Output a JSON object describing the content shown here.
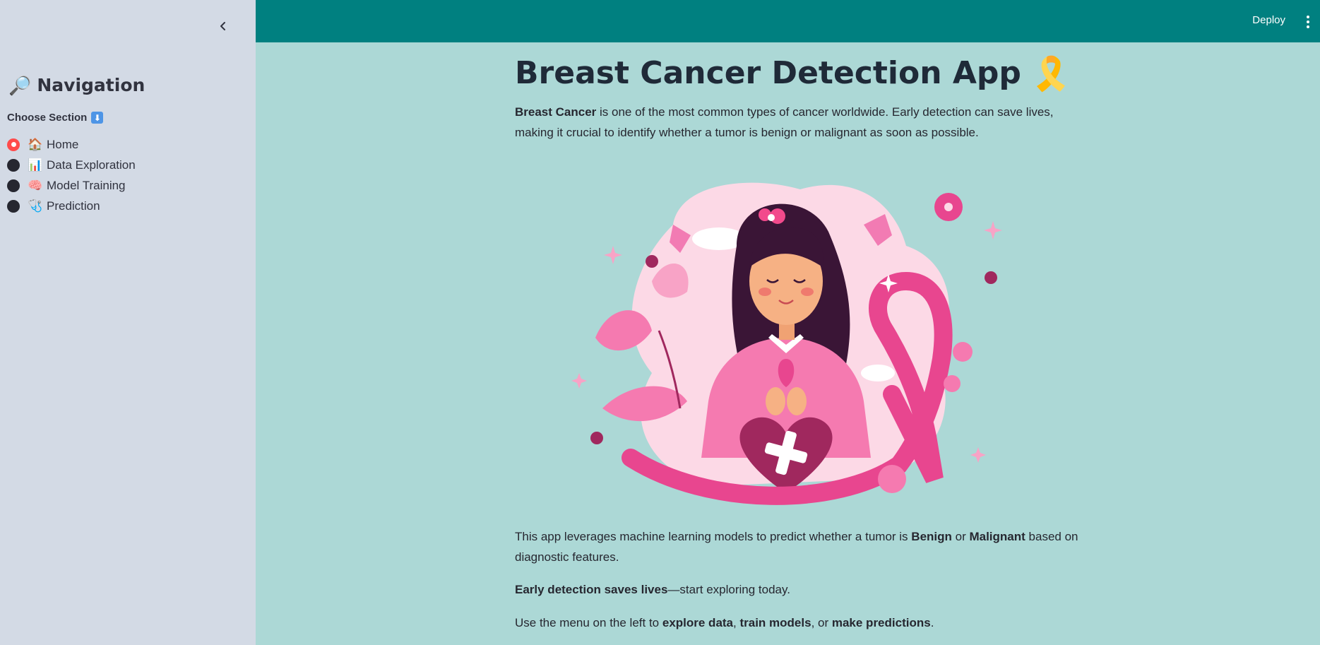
{
  "sidebar": {
    "collapse_icon": "chevron-left-icon",
    "title_emoji": "🔎",
    "title": "Navigation",
    "choose_label": "Choose Section",
    "choose_icon": "⬇",
    "items": [
      {
        "emoji": "🏠",
        "label": "Home",
        "selected": true
      },
      {
        "emoji": "📊",
        "label": "Data Exploration",
        "selected": false
      },
      {
        "emoji": "🧠",
        "label": "Model Training",
        "selected": false
      },
      {
        "emoji": "🩺",
        "label": "Prediction",
        "selected": false
      }
    ]
  },
  "header": {
    "deploy_label": "Deploy",
    "menu_icon": "kebab-menu-icon",
    "background": "#008080"
  },
  "main": {
    "title": "Breast Cancer Detection App",
    "title_emoji": "🎗️",
    "intro": {
      "bold": "Breast Cancer",
      "text": " is one of the most common types of cancer worldwide. Early detection can save lives, making it crucial to identify whether a tumor is benign or malignant as soon as possible."
    },
    "para2": {
      "t1": "This app leverages machine learning models to predict whether a tumor is ",
      "b1": "Benign",
      "t2": " or ",
      "b2": "Malignant",
      "t3": " based on diagnostic features."
    },
    "para3": {
      "b1": "Early detection saves lives",
      "t1": "—start exploring today."
    },
    "para4": {
      "t1": "Use the menu on the left to ",
      "b1": "explore data",
      "t2": ", ",
      "b2": "train models",
      "t3": ", or ",
      "b3": "make predictions",
      "t4": "."
    },
    "background": "#acd8d6"
  },
  "colors": {
    "sidebar_bg": "#d3dae5",
    "radio_active": "#ff4b4b",
    "ribbon_pink": "#e8468f"
  }
}
